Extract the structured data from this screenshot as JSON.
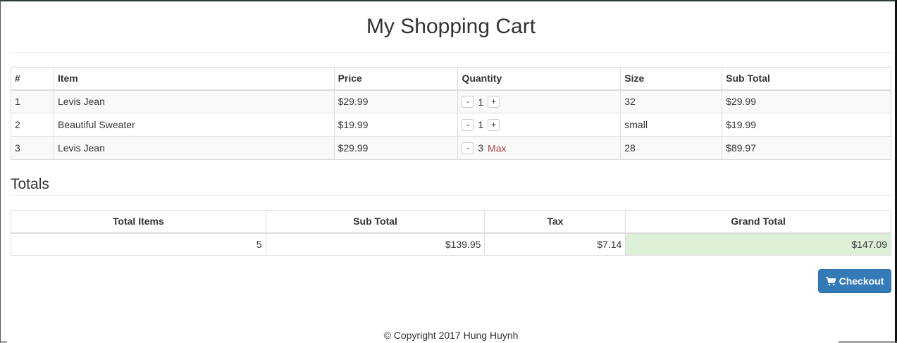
{
  "page": {
    "title": "My Shopping Cart"
  },
  "cart": {
    "headers": [
      "#",
      "Item",
      "Price",
      "Quantity",
      "Size",
      "Sub Total"
    ],
    "rows": [
      {
        "num": "1",
        "item": "Levis Jean",
        "price": "$29.99",
        "qty": "1",
        "size": "32",
        "subtotal": "$29.99",
        "plus": "+",
        "minus": "-",
        "max": ""
      },
      {
        "num": "2",
        "item": "Beautiful Sweater",
        "price": "$19.99",
        "qty": "1",
        "size": "small",
        "subtotal": "$19.99",
        "plus": "+",
        "minus": "-",
        "max": ""
      },
      {
        "num": "3",
        "item": "Levis Jean",
        "price": "$29.99",
        "qty": "3",
        "size": "28",
        "subtotal": "$89.97",
        "plus": "",
        "minus": "-",
        "max": "Max"
      }
    ]
  },
  "totals": {
    "heading": "Totals",
    "headers": [
      "Total Items",
      "Sub Total",
      "Tax",
      "Grand Total"
    ],
    "values": [
      "5",
      "$139.95",
      "$7.14",
      "$147.09"
    ]
  },
  "checkout": {
    "label": "Checkout",
    "icon": "shopping-cart-icon"
  },
  "footer": {
    "text": "© Copyright 2017 Hung Huynh"
  },
  "colors": {
    "primary": "#337ab7",
    "danger": "#a94442",
    "success_bg": "#dff0d8"
  }
}
